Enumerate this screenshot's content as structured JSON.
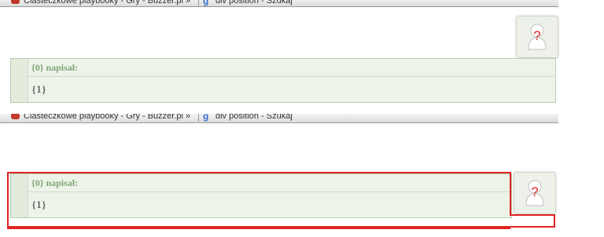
{
  "tabs": [
    {
      "label": "Ciasteczkowe playbooky - Gry - Buzzer.pl »"
    },
    {
      "label": "div position - Szukaj"
    }
  ],
  "quote": {
    "author_line": "{0} napisał:",
    "body": "{1}"
  },
  "avatar": {
    "symbol": "?",
    "icon": "unknown-user-icon"
  },
  "colors": {
    "quote_bg": "#eef3ea",
    "quote_header_text": "#7fa877",
    "highlight": "#e02424"
  }
}
